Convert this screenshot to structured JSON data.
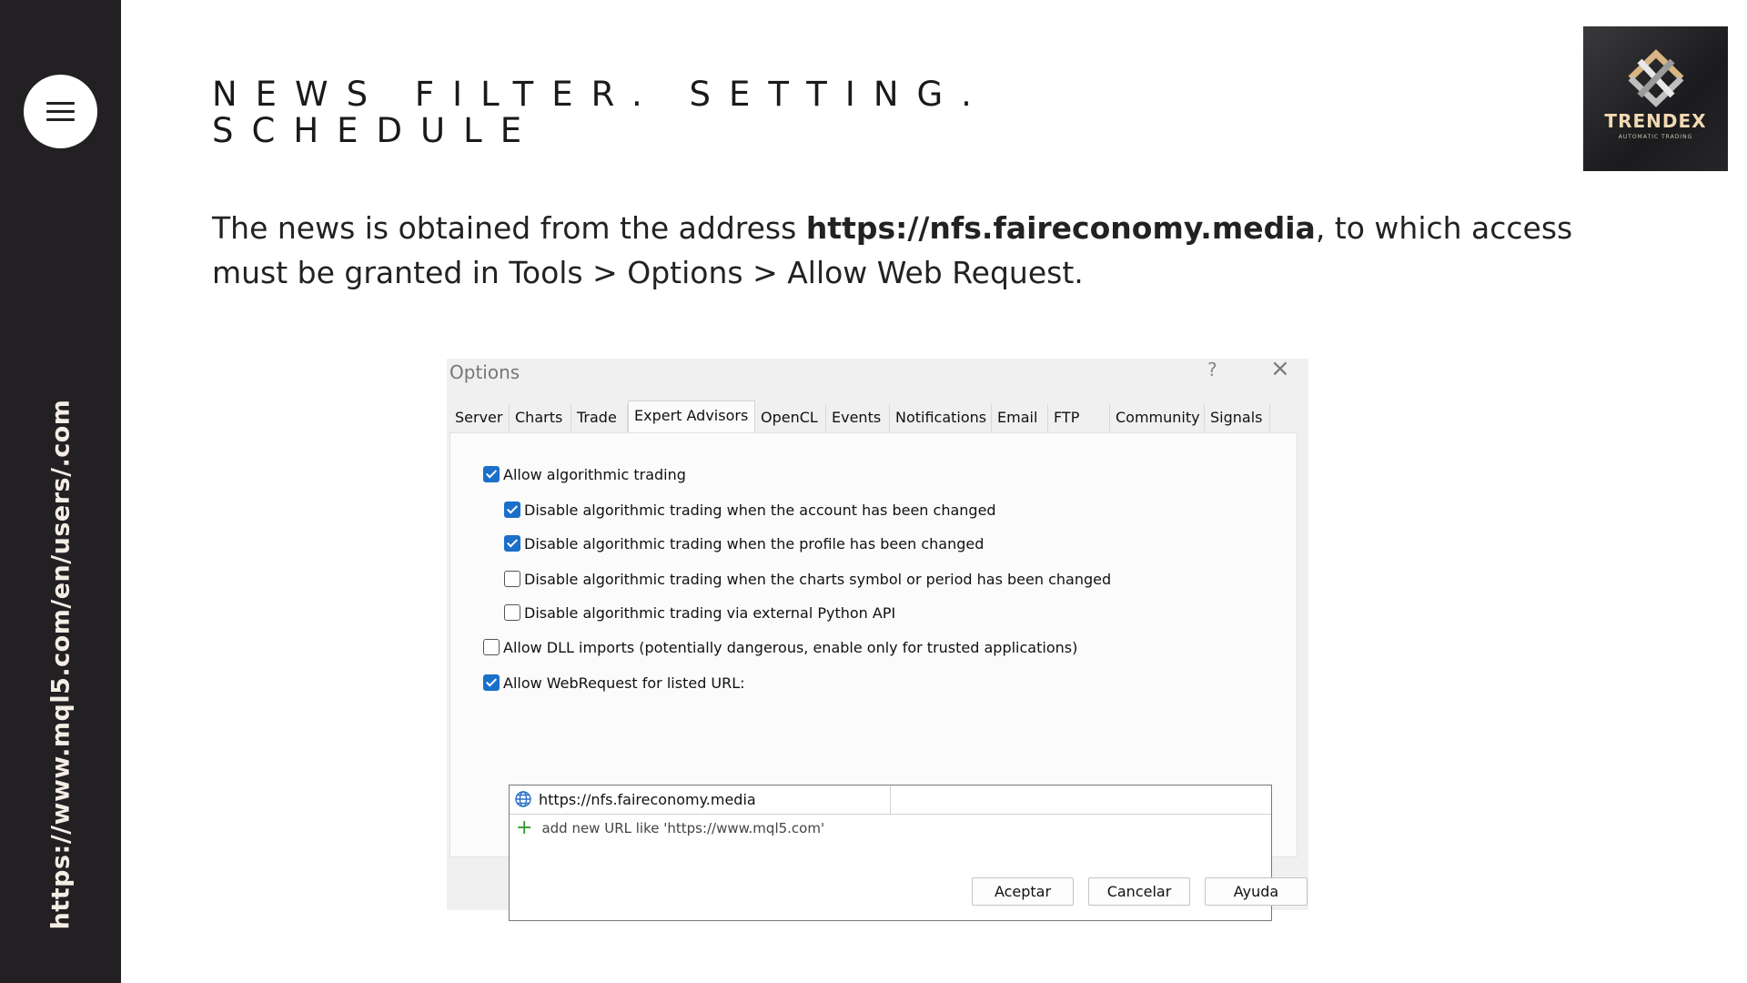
{
  "sidebar": {
    "url_text": "https://www.mql5.com/en/users/.com",
    "menu_icon": "hamburger-menu-icon"
  },
  "header": {
    "title_line1": "NEWS FILTER. SETTING.",
    "title_line2": "SCHEDULE",
    "intro_before": "The news is obtained from the address ",
    "intro_bold": "https://nfs.faireconomy.media",
    "intro_after": ", to which access must be granted in Tools > Options > Allow Web Request."
  },
  "logo": {
    "name": "TRENDEX",
    "tagline": "AUTOMATIC TRADING",
    "accent": "#d8b583"
  },
  "dialog": {
    "title": "Options",
    "help": "?",
    "close": "×",
    "tabs": [
      "Server",
      "Charts",
      "Trade",
      "Expert Advisors",
      "OpenCL",
      "Events",
      "Notifications",
      "Email",
      "FTP",
      "Community",
      "Signals"
    ],
    "active_tab": "Expert Advisors",
    "options": [
      {
        "label": "Allow algorithmic trading",
        "checked": true
      },
      {
        "label": "Disable algorithmic trading when the account has been changed",
        "checked": true
      },
      {
        "label": "Disable algorithmic trading when the profile has been changed",
        "checked": true
      },
      {
        "label": "Disable algorithmic trading when the charts symbol or period has been changed",
        "checked": false
      },
      {
        "label": "Disable algorithmic trading via external Python API",
        "checked": false
      },
      {
        "label": "Allow DLL imports (potentially dangerous, enable only for trusted applications)",
        "checked": false
      },
      {
        "label": "Allow WebRequest for listed URL:",
        "checked": true
      }
    ],
    "urls": [
      "https://nfs.faireconomy.media"
    ],
    "add_url_hint": "add new URL like 'https://www.mql5.com'",
    "buttons": {
      "ok": "Aceptar",
      "cancel": "Cancelar",
      "help": "Ayuda"
    },
    "check_color": "#1a6fc9"
  }
}
